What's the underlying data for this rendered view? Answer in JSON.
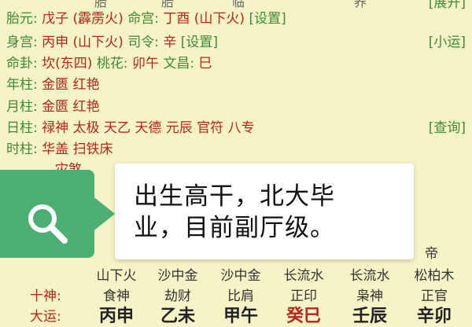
{
  "top_clipped": [
    "胎",
    "胎",
    "临",
    "养",
    "[展开]"
  ],
  "rows": [
    {
      "label": "胎元:",
      "value": "戊子 (霹雳火)",
      "label2": "命宫:",
      "value2": "丁酉 (山下火)",
      "link": "[设置]",
      "right": "[展开]"
    },
    {
      "label": "身宫:",
      "value": "丙申 (山下火)",
      "label2": "司令:",
      "value2": "辛",
      "link": "[设置]",
      "right": "[小运]"
    },
    {
      "label": "命卦:",
      "value": "坎(东四)",
      "label2": "桃花:",
      "value2": "卯午",
      "label3": "文昌:",
      "value3": "巳"
    },
    {
      "label": "年柱:",
      "value": "金匮 红艳"
    },
    {
      "label": "月柱:",
      "value": "金匮 红艳"
    },
    {
      "label": "日柱:",
      "value": "禄神 太极 天乙 天德 元辰 官符 八专",
      "right": "[查询]"
    },
    {
      "label": "时柱:",
      "value": "华盖 扫铁床"
    },
    {
      "label": "",
      "value": "灾煞"
    }
  ],
  "overlay": {
    "text": "出生高干，北大毕\n业，目前副厅级。",
    "icon": "search-icon",
    "accent": "#4caf72"
  },
  "bottom": {
    "top_right": "帝",
    "nayin": [
      "山下火",
      "沙中金",
      "沙中金",
      "长流水",
      "长流水",
      "松柏木"
    ],
    "shishen_label": "十神:",
    "shishen": [
      "食神",
      "劫财",
      "比肩",
      "正印",
      "枭神",
      "正官"
    ],
    "dayun_label": "大运:",
    "dayun": [
      "丙申",
      "乙未",
      "甲午",
      "癸巳",
      "壬辰",
      "辛卯"
    ]
  }
}
